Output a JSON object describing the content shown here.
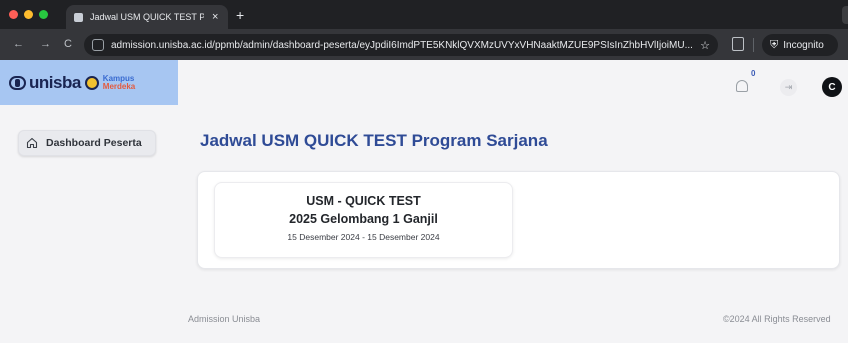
{
  "browser": {
    "tab_title": "Jadwal USM QUICK TEST Pro",
    "tab_close": "×",
    "new_tab": "+",
    "back": "←",
    "forward": "→",
    "reload": "C",
    "url": "admission.unisba.ac.id/ppmb/admin/dashboard-peserta/eyJpdiI6ImdPTE5KNklQVXMzUVYxVHNaaktMZUE9PSIsInZhbHVlIjoiMU...",
    "star": "☆",
    "incognito_label": "Incognito",
    "incognito_glyph": "⛨"
  },
  "header": {
    "logo_text": "unisba",
    "kampus_top": "Kampus",
    "kampus_bottom": "Merdeka",
    "notification_count": "0",
    "logout_glyph": "⇥",
    "avatar_initial": "C"
  },
  "sidebar": {
    "items": [
      {
        "label": "Dashboard Peserta",
        "icon": "home-icon"
      }
    ]
  },
  "main": {
    "title": "Jadwal USM QUICK TEST Program Sarjana",
    "schedules": [
      {
        "title": "USM - QUICK TEST",
        "subtitle": "2025 Gelombang 1 Ganjil",
        "date_range": "15 Desember 2024 - 15 Desember 2024"
      }
    ]
  },
  "footer": {
    "left": "Admission Unisba",
    "right": "©2024 All Rights Reserved"
  },
  "colors": {
    "accent": "#2f4b96",
    "logo_panel": "#a7c6f2"
  }
}
